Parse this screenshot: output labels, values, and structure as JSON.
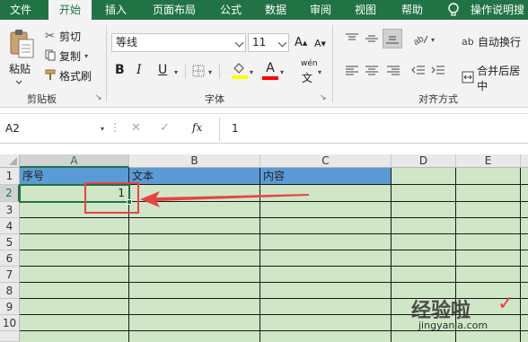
{
  "menu": {
    "tabs": [
      "文件",
      "开始",
      "插入",
      "页面布局",
      "公式",
      "数据",
      "审阅",
      "视图",
      "帮助"
    ],
    "active_index": 1,
    "tell_me": "操作说明搜"
  },
  "clipboard": {
    "paste": "粘贴",
    "cut": "剪切",
    "copy": "复制",
    "format_painter": "格式刷",
    "label": "剪贴板"
  },
  "font": {
    "name": "等线",
    "size": "11",
    "bold": "B",
    "italic": "I",
    "underline": "U",
    "grow": "A",
    "shrink": "A",
    "label": "字体",
    "fill_color": "#ffff00",
    "font_color": "#ff0000",
    "phonetic": "wén"
  },
  "alignment": {
    "wrap_text": "自动换行",
    "merge_center": "合并后居中",
    "label": "对齐方式"
  },
  "formula_bar": {
    "name_box": "A2",
    "fx": "fx",
    "value": "1"
  },
  "sheet": {
    "columns": [
      "A",
      "B",
      "C",
      "D",
      "E"
    ],
    "rows": [
      "1",
      "2",
      "3",
      "4",
      "5",
      "6",
      "7",
      "8",
      "9",
      "10"
    ],
    "header_cells": [
      "序号",
      "文本",
      "内容"
    ],
    "a2_value": "1",
    "header_fill": "#5b9bd5",
    "body_fill": "#cfe6c7"
  },
  "watermark": {
    "text": "经验啦",
    "url": "jingyanla.com"
  },
  "accent": "#217346",
  "annotation_color": "#e84343"
}
